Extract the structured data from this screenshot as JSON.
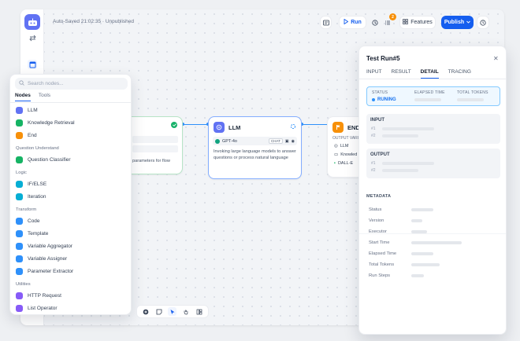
{
  "header": {
    "autosave": "Auto-Saved 21:02:35 · Unpublished",
    "run_label": "Run",
    "features_label": "Features",
    "publish_label": "Publish",
    "checklist_badge": "2"
  },
  "nodes": {
    "start": {
      "desc": "parameters for flow"
    },
    "llm": {
      "title": "LLM",
      "model": "GPT-4o",
      "mode_tag": "CHAT",
      "desc": "Invoking large language models to answer questions or process natural language"
    },
    "end": {
      "title": "END",
      "output_label": "OUTPUT VARIA",
      "vars": [
        "LLM",
        "Knowled",
        "DALL-E"
      ]
    }
  },
  "palette": {
    "search_placeholder": "Search nodes...",
    "tabs": [
      "Nodes",
      "Tools"
    ],
    "items": [
      {
        "label": "LLM",
        "color": "#6172f3"
      },
      {
        "label": "Knowledge Retrieval",
        "color": "#16b364"
      },
      {
        "label": "End",
        "color": "#f79009"
      }
    ],
    "groups": [
      {
        "title": "Question Understand",
        "items": [
          {
            "label": "Question Classifier",
            "color": "#16b364"
          }
        ]
      },
      {
        "title": "Logic",
        "items": [
          {
            "label": "IF/ELSE",
            "color": "#06aed4"
          },
          {
            "label": "Iteration",
            "color": "#06aed4"
          }
        ]
      },
      {
        "title": "Transform",
        "items": [
          {
            "label": "Code",
            "color": "#2e90fa"
          },
          {
            "label": "Template",
            "color": "#2e90fa"
          },
          {
            "label": "Variable Aggregator",
            "color": "#2e90fa"
          },
          {
            "label": "Variable Assigner",
            "color": "#2e90fa"
          },
          {
            "label": "Parameter Extractor",
            "color": "#2e90fa"
          }
        ]
      },
      {
        "title": "Utilities",
        "items": [
          {
            "label": "HTTP Request",
            "color": "#875bf7"
          },
          {
            "label": "List Operator",
            "color": "#875bf7"
          }
        ]
      }
    ]
  },
  "panel": {
    "title": "Test Run#5",
    "tabs": [
      "INPUT",
      "RESULT",
      "DETAIL",
      "TRACING"
    ],
    "status_label": "STATUS",
    "status_value": "RUNING",
    "elapsed_label": "ELAPSED TIME",
    "tokens_label": "TOTAL TOKENS",
    "input_title": "INPUT",
    "output_title": "OUTPUT",
    "row_num_1": "#1",
    "row_num_2": "#2",
    "metadata_title": "METADATA",
    "metadata_rows": [
      "Status",
      "Version",
      "Executor",
      "Start Time",
      "Elapsed Time",
      "Total Tokens",
      "Run Steps"
    ]
  }
}
